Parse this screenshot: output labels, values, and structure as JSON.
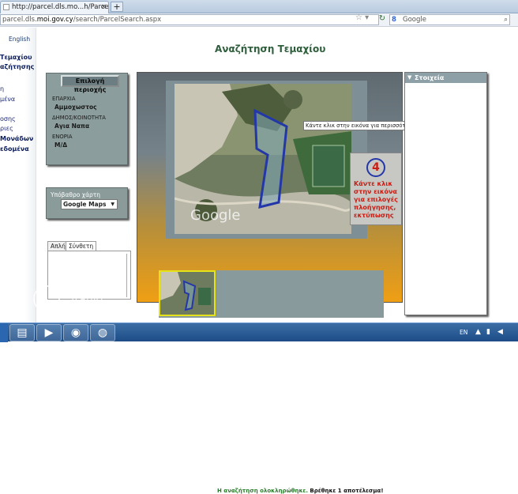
{
  "browser": {
    "tab_title": "http://parcel.dls.mo...h/ParcelSearch.aspx",
    "new_tab_label": "+",
    "url_prefix": "parcel.dls.",
    "url_domain": "moi.gov.cy",
    "url_path": "/search/ParcelSearch.aspx",
    "search_placeholder": "Google"
  },
  "leftnav": {
    "language": "English",
    "items": [
      "Τεμαχίου",
      "αζήτησης",
      "η",
      "μένα",
      "οσης",
      "ριες",
      "Μονάδων",
      "εδομένα"
    ]
  },
  "page_title": "Αναζήτηση Τεμαχίου",
  "region_panel": {
    "button_label": "Επιλογή περιοχής",
    "fields": [
      {
        "label": "ΕΠΑΡΧΙΑ",
        "value": "Αμμοχωστος"
      },
      {
        "label": "ΔΗΜΟΣ/ΚΟΙΝΟΤΗΤΑ",
        "value": "Αγια Ναπα"
      },
      {
        "label": "ΕΝΟΡΙΑ",
        "value": "Μ/Δ"
      }
    ]
  },
  "basemap": {
    "label": "Υπόβαθρο χάρτη",
    "selected": "Google Maps"
  },
  "mode_tabs": [
    "Απλή",
    "Σύνθετη"
  ],
  "map": {
    "tooltip": "Κάντε κλικ στην εικόνα για περισσότερες",
    "google_watermark": "Google",
    "callout_number": "4",
    "callout_text": "Κάντε κλικ στην εικόνα για επιλογές πλοήγησης, εκτύπωσης",
    "status_ok": "Η αναζήτηση ολοκληρώθηκε.",
    "status_result": "Βρέθηκε 1 αποτέλεσμα!"
  },
  "info_panel": {
    "title": "Στοιχεία"
  },
  "watermark_text": "Tranio",
  "taskbar": {
    "lang": "EN"
  },
  "colors": {
    "title_green": "#2e5e3b",
    "callout_red": "#c81e14",
    "parcel_blue": "#2437a8",
    "frame_orange": "#ef9f14",
    "status_green": "#2d7d2e"
  }
}
